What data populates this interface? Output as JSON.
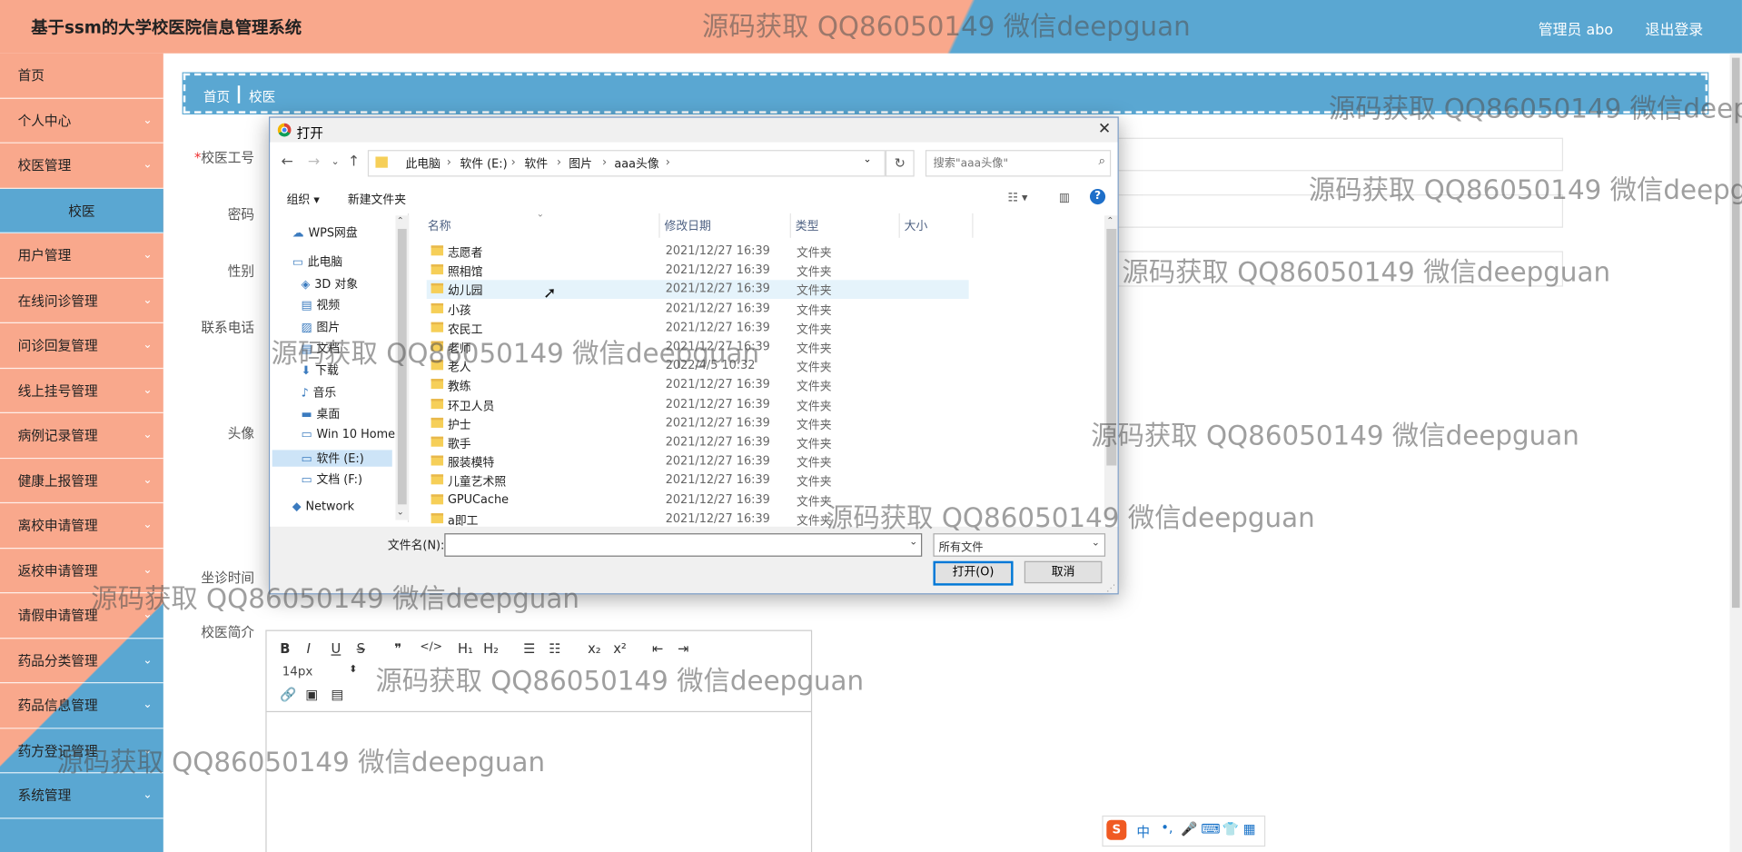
{
  "header": {
    "app_title": "基于ssm的大学校医院信息管理系统",
    "admin_label": "管理员 abo",
    "logout_label": "退出登录"
  },
  "sidebar": {
    "items": [
      {
        "label": "首页",
        "has_arrow": false
      },
      {
        "label": "个人中心",
        "has_arrow": true
      },
      {
        "label": "校医管理",
        "has_arrow": true
      },
      {
        "label": "校医",
        "has_arrow": false,
        "sub": true
      },
      {
        "label": "用户管理",
        "has_arrow": true
      },
      {
        "label": "在线问诊管理",
        "has_arrow": true
      },
      {
        "label": "问诊回复管理",
        "has_arrow": true
      },
      {
        "label": "线上挂号管理",
        "has_arrow": true
      },
      {
        "label": "病例记录管理",
        "has_arrow": true
      },
      {
        "label": "健康上报管理",
        "has_arrow": true
      },
      {
        "label": "离校申请管理",
        "has_arrow": true
      },
      {
        "label": "返校申请管理",
        "has_arrow": true
      },
      {
        "label": "请假申请管理",
        "has_arrow": true
      },
      {
        "label": "药品分类管理",
        "has_arrow": true
      },
      {
        "label": "药品信息管理",
        "has_arrow": true
      },
      {
        "label": "药方登记管理",
        "has_arrow": true
      },
      {
        "label": "系统管理",
        "has_arrow": true
      }
    ]
  },
  "breadcrumb": {
    "home": "首页",
    "current": "校医"
  },
  "form": {
    "required_mark": "*",
    "labels": {
      "id": "校医工号",
      "password": "密码",
      "gender": "性别",
      "phone": "联系电话",
      "avatar": "头像",
      "time": "坐诊时间",
      "intro": "校医简介"
    }
  },
  "editor": {
    "font_size": "14px",
    "toolbar_row1": [
      "B",
      "I",
      "U",
      "S",
      "❞",
      "</>",
      "H₁",
      "H₂",
      "☰",
      "☷",
      "x₂",
      "x²",
      "⇤",
      "⇥"
    ]
  },
  "dialog": {
    "title": "打开",
    "path": [
      "此电脑",
      "软件 (E:)",
      "软件",
      "图片",
      "aaa头像"
    ],
    "search_placeholder": "搜索\"aaa头像\"",
    "organize_label": "组织 ▾",
    "new_folder_label": "新建文件夹",
    "nav_items": [
      {
        "label": "WPS网盘",
        "icon": "cloud-icon"
      },
      {
        "label": "此电脑",
        "icon": "computer-icon"
      },
      {
        "label": "3D 对象",
        "icon": "cube-icon"
      },
      {
        "label": "视频",
        "icon": "video-icon"
      },
      {
        "label": "图片",
        "icon": "picture-icon"
      },
      {
        "label": "文档",
        "icon": "document-icon"
      },
      {
        "label": "下载",
        "icon": "download-icon"
      },
      {
        "label": "音乐",
        "icon": "music-icon"
      },
      {
        "label": "桌面",
        "icon": "desktop-icon"
      },
      {
        "label": "Win 10 Home",
        "icon": "drive-icon"
      },
      {
        "label": "软件 (E:)",
        "icon": "drive-icon",
        "selected": true
      },
      {
        "label": "文档 (F:)",
        "icon": "drive-icon"
      },
      {
        "label": "Network",
        "icon": "network-icon"
      }
    ],
    "columns": [
      "名称",
      "修改日期",
      "类型",
      "大小"
    ],
    "files": [
      {
        "name": "志愿者",
        "date": "2021/12/27 16:39",
        "type": "文件夹"
      },
      {
        "name": "照相馆",
        "date": "2021/12/27 16:39",
        "type": "文件夹"
      },
      {
        "name": "幼儿园",
        "date": "2021/12/27 16:39",
        "type": "文件夹",
        "hover": true
      },
      {
        "name": "小孩",
        "date": "2021/12/27 16:39",
        "type": "文件夹"
      },
      {
        "name": "农民工",
        "date": "2021/12/27 16:39",
        "type": "文件夹"
      },
      {
        "name": "老师",
        "date": "2021/12/27 16:39",
        "type": "文件夹"
      },
      {
        "name": "老人",
        "date": "2022/4/5 10:32",
        "type": "文件夹"
      },
      {
        "name": "教练",
        "date": "2021/12/27 16:39",
        "type": "文件夹"
      },
      {
        "name": "环卫人员",
        "date": "2021/12/27 16:39",
        "type": "文件夹"
      },
      {
        "name": "护士",
        "date": "2021/12/27 16:39",
        "type": "文件夹"
      },
      {
        "name": "歌手",
        "date": "2021/12/27 16:39",
        "type": "文件夹"
      },
      {
        "name": "服装模特",
        "date": "2021/12/27 16:39",
        "type": "文件夹"
      },
      {
        "name": "儿童艺术照",
        "date": "2021/12/27 16:39",
        "type": "文件夹"
      },
      {
        "name": "GPUCache",
        "date": "2021/12/27 16:39",
        "type": "文件夹"
      },
      {
        "name": "a即工",
        "date": "2021/12/27 16:39",
        "type": "文件夹"
      }
    ],
    "filename_label": "文件名(N):",
    "filename_value": "",
    "filetype_value": "所有文件",
    "open_label": "打开(O)",
    "cancel_label": "取消"
  },
  "ime": {
    "label": "中"
  },
  "watermark": "源码获取 QQ86050149 微信deepguan",
  "colors": {
    "salmon": "#f9a88c",
    "blue": "#5aa7d2"
  }
}
